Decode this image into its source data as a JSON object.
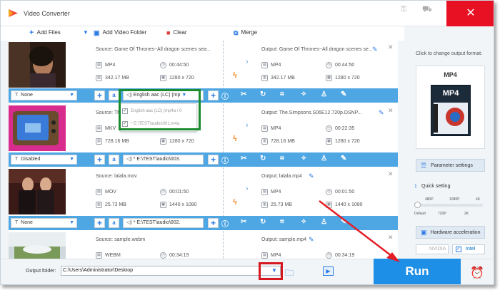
{
  "window": {
    "title": "Video Converter",
    "close_label": "✕",
    "minimize_label": "—",
    "restore_label": "□"
  },
  "toolbar": {
    "add_files": "Add Files",
    "add_video_folder": "Add Video Folder",
    "clear": "Clear",
    "merge": "Merge"
  },
  "items": [
    {
      "source": "Source: Game Of Thrones~All dragon scenes sea...",
      "output": "Output: Game Of Thrones~All dragon scenes se...",
      "src_format": "MP4",
      "src_duration": "00:44:50",
      "src_size": "342.17 MB",
      "src_res": "1280 x 720",
      "out_format": "MP4",
      "out_duration": "00:44:50",
      "out_size": "342.17 MB",
      "out_res": "1280 x 720",
      "subtitle": "None",
      "audio": "English aac (LC) (mp"
    },
    {
      "source": "Source: The Simpsons S06E12 720p WEB-...",
      "output": "Output: The.Simpsons.S06E12.720p.DSNP...",
      "src_format": "MKV",
      "src_duration": "00:22:35",
      "src_size": "728.16 MB",
      "src_res": "1280 x 720",
      "out_format": "MP4",
      "out_duration": "00:22:35",
      "out_size": "728.16 MB",
      "out_res": "1280 x 720",
      "subtitle": "Disabled",
      "audio": "* E:\\TEST\\audio\\003."
    },
    {
      "source": "Source: lalala.mov",
      "output": "Output: lalala.mp4",
      "src_format": "MOV",
      "src_duration": "00:01:50",
      "src_size": "25.73 MB",
      "src_res": "1440 x 1080",
      "out_format": "MP4",
      "out_duration": "00:01:50",
      "out_size": "25.73 MB",
      "out_res": "1440 x 1080",
      "subtitle": "None",
      "audio": "* E:\\TEST\\audio\\002."
    },
    {
      "source": "Source: sample.webm",
      "output": "Output: sample.mp4",
      "src_format": "WEBM",
      "src_duration": "00:34:19",
      "out_format": "MP4",
      "out_duration": "00:34:19"
    }
  ],
  "audio_popup": {
    "option_1": "English aac (LC) (mp4a / 0",
    "option_2": "* E:\\TEST\\audio\\001.m4a"
  },
  "right_panel": {
    "format_hint": "Click to change output format:",
    "format": "MP4",
    "format_box_text": "MP4",
    "parameter_settings": "Parameter settings",
    "quick_setting": "Quick setting",
    "quick_top_ticks": [
      "480P",
      "1080P",
      "4K"
    ],
    "quick_bottom_ticks": [
      "Default",
      "720P",
      "2K"
    ],
    "quick_level": 0.0,
    "hardware_acceleration": "Hardware acceleration",
    "gpu_nvidia": "NVIDIA",
    "gpu_intel": "Intel"
  },
  "bottom": {
    "output_folder_label": "Output folder:",
    "output_folder_value": "C:\\Users\\Administrator\\Desktop",
    "run": "Run"
  },
  "colors": {
    "accent": "#4ea6e3",
    "run": "#1e8fe6",
    "close": "#e81123",
    "highlight_green": "#1a8b2e",
    "highlight_red": "#d6181f"
  },
  "icons": [
    "plus-icon",
    "folder-plus-icon",
    "trash-icon",
    "merge-icon",
    "text-icon",
    "speaker-icon",
    "info-icon",
    "scissors-icon",
    "rotate-icon",
    "crop-icon",
    "magic-wand-icon",
    "stamp-icon",
    "edit-icon",
    "bolt-icon",
    "folder-icon",
    "alarm-clock-icon"
  ]
}
